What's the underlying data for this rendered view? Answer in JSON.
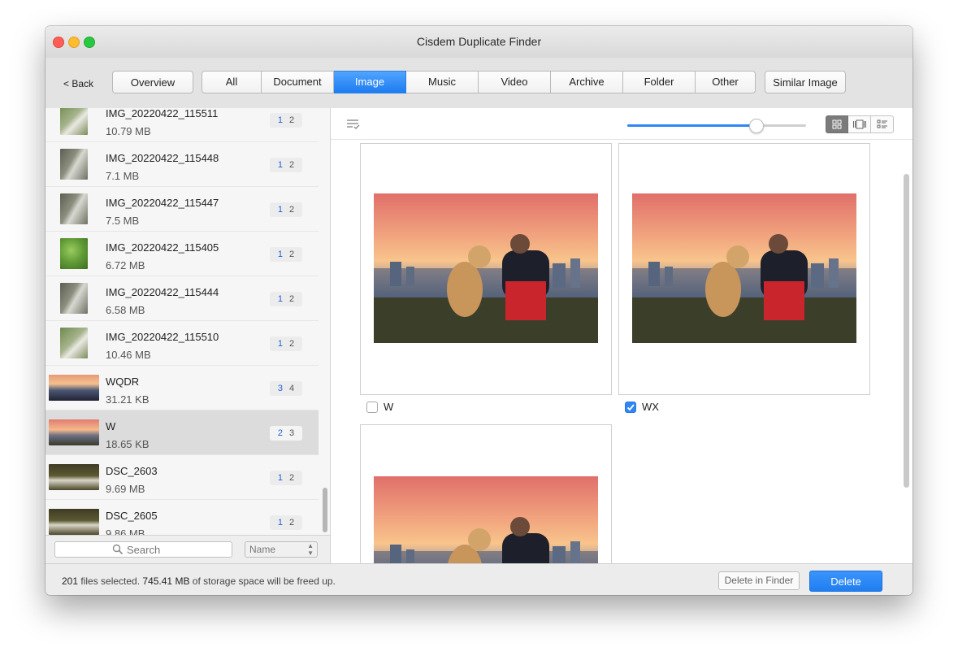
{
  "window": {
    "title": "Cisdem Duplicate Finder"
  },
  "toolbar": {
    "back_label": "< Back",
    "overview_label": "Overview",
    "tabs": [
      {
        "label": "All"
      },
      {
        "label": "Document"
      },
      {
        "label": "Image",
        "active": true
      },
      {
        "label": "Music"
      },
      {
        "label": "Video"
      },
      {
        "label": "Archive"
      },
      {
        "label": "Folder"
      },
      {
        "label": "Other"
      }
    ],
    "similar_image_label": "Similar Image"
  },
  "sidebar": {
    "items": [
      {
        "name": "IMG_20220422_115511",
        "size": "10.79 MB",
        "count_a": "1",
        "count_b": "2",
        "thumb": "green-stairs"
      },
      {
        "name": "IMG_20220422_115448",
        "size": "7.1 MB",
        "count_a": "1",
        "count_b": "2",
        "thumb": "stairs"
      },
      {
        "name": "IMG_20220422_115447",
        "size": "7.5 MB",
        "count_a": "1",
        "count_b": "2",
        "thumb": "stairs"
      },
      {
        "name": "IMG_20220422_115405",
        "size": "6.72 MB",
        "count_a": "1",
        "count_b": "2",
        "thumb": "leaves"
      },
      {
        "name": "IMG_20220422_115444",
        "size": "6.58 MB",
        "count_a": "1",
        "count_b": "2",
        "thumb": "stairs"
      },
      {
        "name": "IMG_20220422_115510",
        "size": "10.46 MB",
        "count_a": "1",
        "count_b": "2",
        "thumb": "green-stairs"
      },
      {
        "name": "WQDR",
        "size": "31.21 KB",
        "count_a": "3",
        "count_b": "4",
        "thumb": "sunset"
      },
      {
        "name": "W",
        "size": "18.65 KB",
        "count_a": "2",
        "count_b": "3",
        "thumb": "sunset-dog",
        "selected": true
      },
      {
        "name": "DSC_2603",
        "size": "9.69 MB",
        "count_a": "1",
        "count_b": "2",
        "thumb": "dog-forest"
      },
      {
        "name": "DSC_2605",
        "size": "9.86 MB",
        "count_a": "1",
        "count_b": "2",
        "thumb": "dog-forest"
      }
    ],
    "search_placeholder": "Search",
    "sort_value": "Name"
  },
  "main": {
    "zoom_percent": 72,
    "cards": [
      {
        "label": "W",
        "checked": false
      },
      {
        "label": "WX",
        "checked": true
      },
      {
        "label": "",
        "checked": false
      }
    ]
  },
  "status": {
    "count": "201",
    "count_suffix": " files selected. ",
    "size": "745.41 MB",
    "size_suffix": " of storage space will be freed up.",
    "delete_in_finder_label": "Delete in Finder",
    "delete_label": "Delete"
  },
  "colors": {
    "accent": "#2f86f4",
    "active_tab": "#1c7cf0"
  }
}
